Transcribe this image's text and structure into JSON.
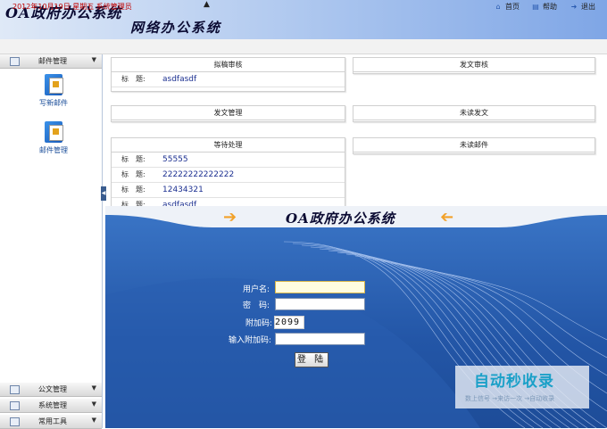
{
  "header": {
    "app_title": "OA政府办公系统",
    "app_subtitle": "网络办公系统"
  },
  "statusbar": {
    "text": "2012年10月19日 星期五 系统管理员",
    "links": [
      {
        "label": "首页",
        "icon": "home-icon"
      },
      {
        "label": "帮助",
        "icon": "help-book-icon"
      },
      {
        "label": "退出",
        "icon": "logout-runner-icon"
      }
    ]
  },
  "sidebar": {
    "mail_group": "邮件管理",
    "tools": [
      "写新邮件",
      "邮件管理"
    ],
    "bottom_groups": [
      "公文管理",
      "系统管理",
      "常用工具"
    ]
  },
  "panels": {
    "draft_review": {
      "title": "拟稿审核",
      "rows": [
        {
          "label": "标　题:",
          "value": "asdfasdf"
        }
      ]
    },
    "doc_review": {
      "title": "发文审核"
    },
    "doc_management": {
      "title": "发文管理"
    },
    "unread_docs": {
      "title": "未读发文"
    },
    "pending": {
      "title": "等待处理",
      "rows": [
        {
          "label": "标　题:",
          "value": "55555"
        },
        {
          "label": "标　题:",
          "value": "22222222222222"
        },
        {
          "label": "标　题:",
          "value": "12434321"
        },
        {
          "label": "标　题:",
          "value": "asdfasdf"
        }
      ]
    },
    "unread_mail": {
      "title": "未读邮件"
    }
  },
  "banner": {
    "title": "OA政府办公系统"
  },
  "login": {
    "username_label": "用户名:",
    "password_label": "密　码:",
    "captcha_label": "附加码:",
    "captcha_value": "2099",
    "captcha_input_label": "输入附加码:",
    "submit_label": "登 陆"
  },
  "watermark": {
    "main": "自动秒收录",
    "sub": "数上信号 →来访一次 →自动收录"
  },
  "colors": {
    "status_text": "#c00000",
    "banner_blue": "#2356a7",
    "arrow_orange": "#f2a22a",
    "link_blue": "#1b2f90"
  }
}
